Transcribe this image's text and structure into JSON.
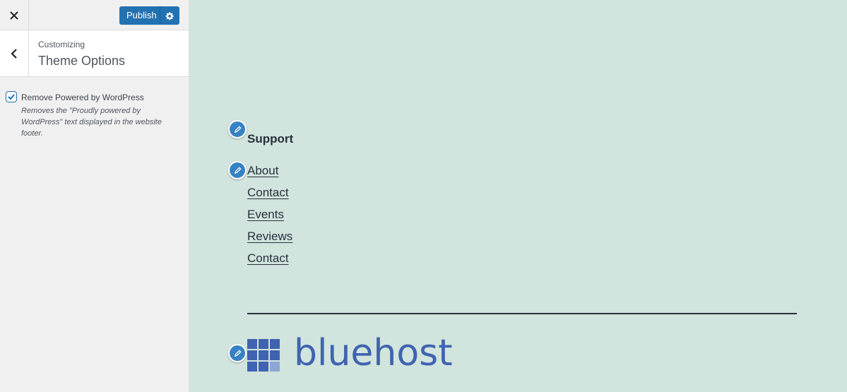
{
  "sidebar": {
    "publish_label": "Publish",
    "customizing_label": "Customizing",
    "section_title": "Theme Options",
    "option": {
      "label": "Remove Powered by WordPress",
      "checked": true,
      "description": "Removes the \"Proudly powered by WordPress\" text displayed in the website footer."
    },
    "accent_color": "#2271b1"
  },
  "preview": {
    "widget_title": "Support",
    "nav_items": [
      "About",
      "Contact",
      "Events",
      "Reviews",
      "Contact"
    ],
    "logo_text": "bluehost",
    "background_color": "#d1e4dd"
  }
}
